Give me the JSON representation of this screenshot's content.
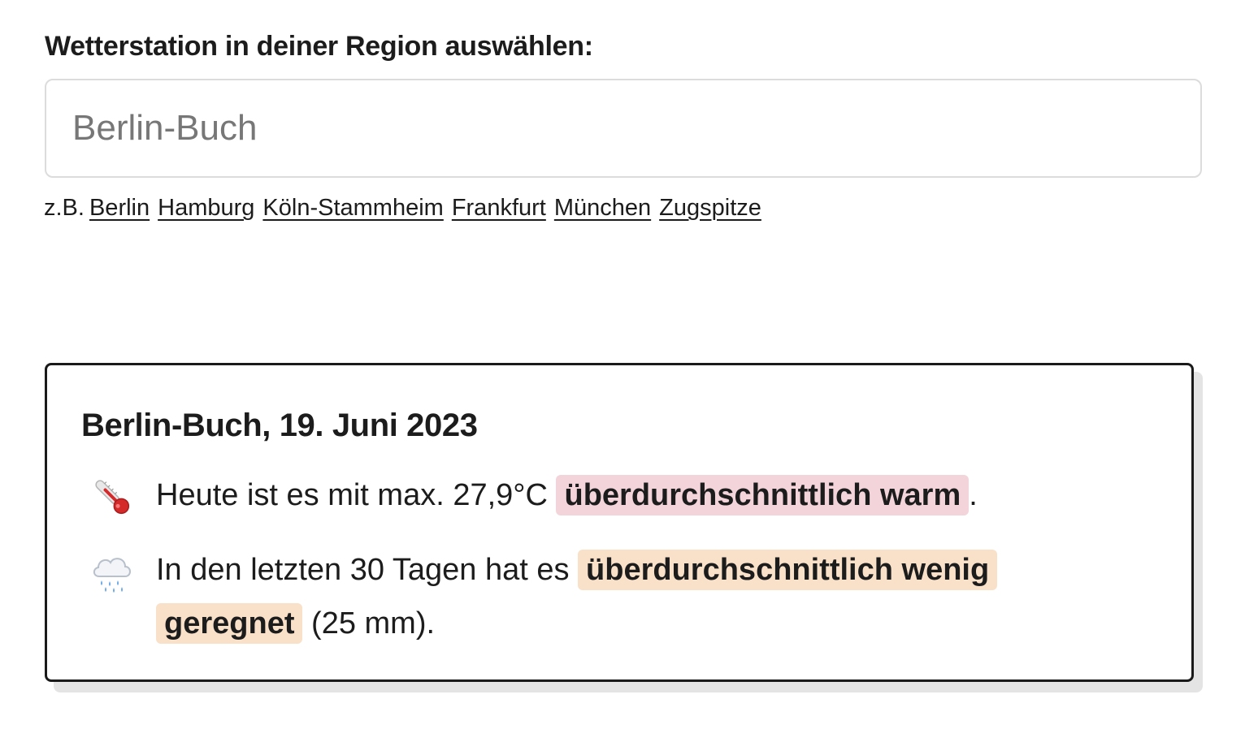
{
  "station_picker": {
    "label": "Wetterstation in deiner Region auswählen:",
    "input_value": "Berlin-Buch",
    "examples_prefix": "z.B.",
    "examples": [
      "Berlin",
      "Hamburg",
      "Köln-Stammheim",
      "Frankfurt",
      "München",
      "Zugspitze"
    ]
  },
  "report": {
    "title": "Berlin-Buch, 19. Juni 2023",
    "temperature": {
      "icon": "thermometer-icon",
      "text_before": "Heute ist es mit max. 27,9°C ",
      "highlight": "überdurchschnittlich warm",
      "text_after": ".",
      "highlight_color": "#f2d4da"
    },
    "rain": {
      "icon": "cloud-with-rain-icon",
      "text_before": "In den letzten 30 Tagen hat es ",
      "highlight": "überdurchschnittlich wenig geregnet",
      "text_after": " (25 mm).",
      "highlight_color": "#f9e0c9"
    }
  }
}
